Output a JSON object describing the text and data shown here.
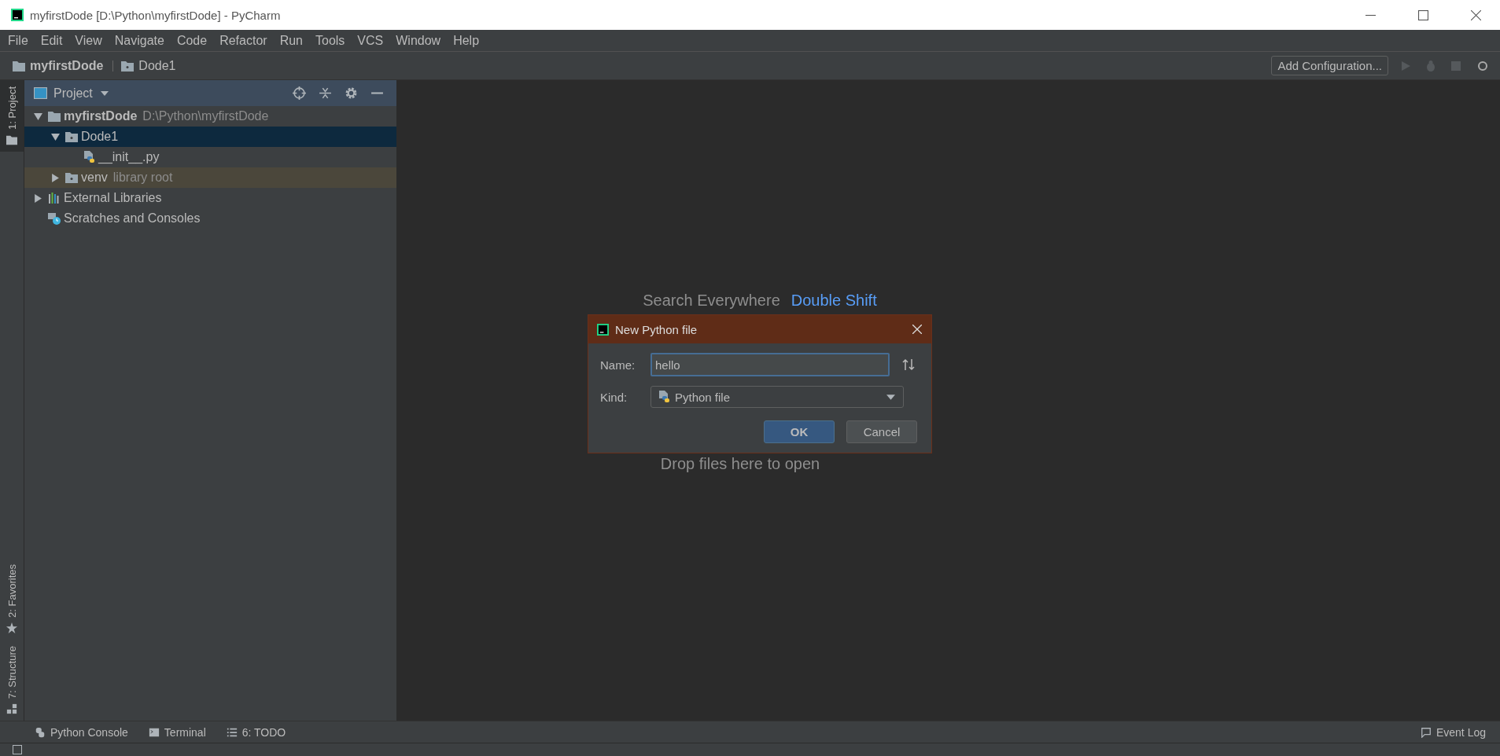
{
  "window": {
    "title": "myfirstDode [D:\\Python\\myfirstDode] - PyCharm"
  },
  "menu": [
    "File",
    "Edit",
    "View",
    "Navigate",
    "Code",
    "Refactor",
    "Run",
    "Tools",
    "VCS",
    "Window",
    "Help"
  ],
  "breadcrumb": [
    {
      "label": "myfirstDode",
      "bold": true
    },
    {
      "label": "Dode1",
      "bold": false
    }
  ],
  "toolbar": {
    "configuration_button": "Add Configuration..."
  },
  "side_tabs": [
    {
      "label": "1: Project",
      "selected": true,
      "kind": "folder"
    },
    {
      "label": "2: Favorites",
      "selected": false,
      "kind": "star"
    },
    {
      "label": "7: Structure",
      "selected": false,
      "kind": "structure"
    }
  ],
  "project_panel": {
    "title": "Project",
    "tree": [
      {
        "label": "myfirstDode",
        "hint": "D:\\Python\\myfirstDode",
        "kind": "folder",
        "bold": true,
        "expanded": true,
        "selected": false,
        "children": [
          {
            "label": "Dode1",
            "kind": "package",
            "bold": false,
            "expanded": true,
            "selected": true,
            "children": [
              {
                "label": "__init__.py",
                "kind": "python",
                "bold": false,
                "selected": false
              }
            ]
          },
          {
            "label": "venv",
            "hint": "library root",
            "kind": "library_root",
            "bold": false,
            "expanded": false,
            "selected": false
          }
        ]
      },
      {
        "label": "External Libraries",
        "kind": "libraries",
        "bold": false,
        "expanded": false,
        "selected": false
      },
      {
        "label": "Scratches and Consoles",
        "kind": "scratches",
        "bold": false,
        "selected": false
      }
    ]
  },
  "editor": {
    "search_hint": "Search Everywhere",
    "search_shortcut": "Double Shift",
    "drop_hint": "Drop files here to open"
  },
  "dialog": {
    "title": "New Python file",
    "name_label": "Name:",
    "name_value": "hello",
    "kind_label": "Kind:",
    "kind_value": "Python file",
    "buttons": [
      {
        "label": "OK",
        "kind": "primary"
      },
      {
        "label": "Cancel",
        "kind": "secondary"
      }
    ]
  },
  "bottom_tabs": [
    {
      "label": "Python Console",
      "kind": "console"
    },
    {
      "label": "Terminal",
      "kind": "terminal"
    },
    {
      "label": "6: TODO",
      "kind": "todo"
    }
  ],
  "event_log": "Event Log"
}
